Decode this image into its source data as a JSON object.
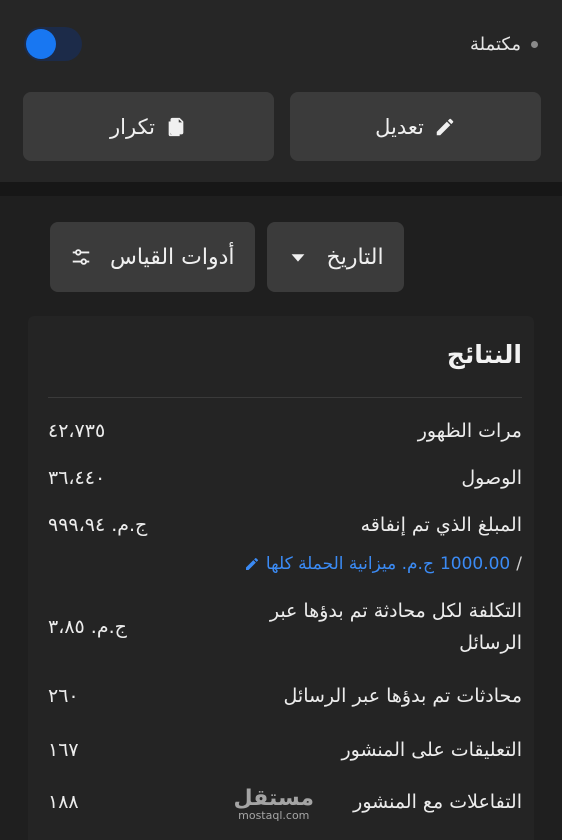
{
  "status": {
    "label": "مكتملة",
    "toggle_on": true
  },
  "actions": {
    "edit_label": "تعديل",
    "duplicate_label": "تكرار"
  },
  "filters": {
    "date_label": "التاريخ",
    "metrics_label": "أدوات القياس"
  },
  "results": {
    "title": "النتائج",
    "rows": [
      {
        "label": "مرات الظهور",
        "value": "٤٢،٧٣٥"
      },
      {
        "label": "الوصول",
        "value": "٣٦،٤٤٠"
      },
      {
        "label": "المبلغ الذي تم إنفاقه",
        "value": "ج.م. ٩٩٩،٩٤"
      },
      {
        "label": "التكلفة لكل محادثة تم بدؤها عبر الرسائل",
        "value": "ج.م. ٣،٨٥"
      },
      {
        "label": "محادثات تم بدؤها عبر الرسائل",
        "value": "٢٦٠"
      },
      {
        "label": "التعليقات على المنشور",
        "value": "١٦٧"
      },
      {
        "label": "التفاعلات مع المنشور",
        "value": "١٨٨"
      }
    ],
    "budget": {
      "amount": "1000.00",
      "text": "ج.م. ميزانية الحملة كلها",
      "slash": "/"
    }
  },
  "watermark": {
    "main": "مستقل",
    "sub": "mostaql.com"
  },
  "colors": {
    "accent": "#1877f2",
    "link": "#3b8bf5",
    "background": "#1f1f1f"
  }
}
